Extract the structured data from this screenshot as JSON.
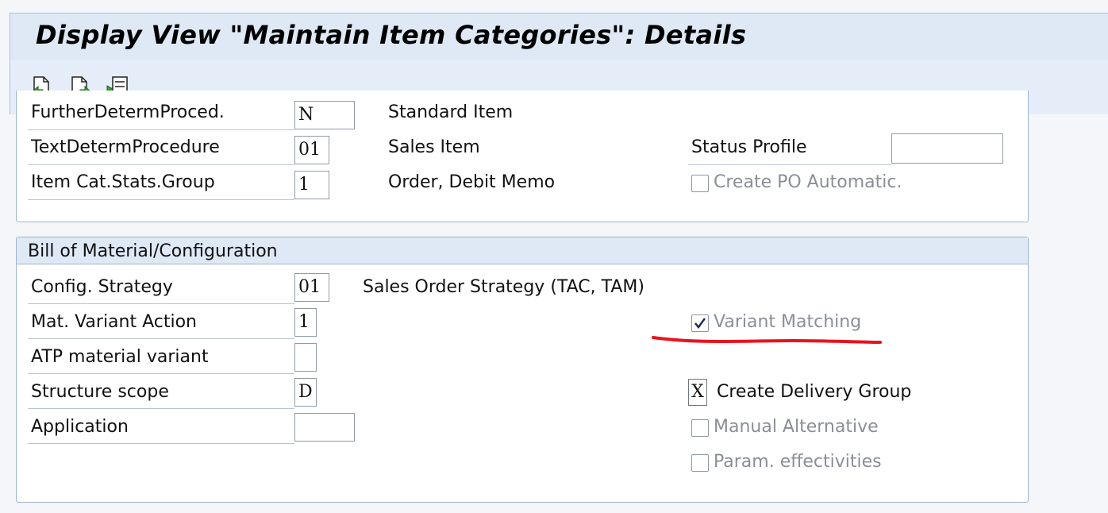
{
  "window": {
    "title": "Display View \"Maintain Item Categories\": Details"
  },
  "toolbar": {
    "icons": [
      "previous-entry-icon",
      "next-entry-icon",
      "other-entry-icon"
    ]
  },
  "group_top": {
    "rows": [
      {
        "label": "FurtherDetermProced.",
        "value": "N",
        "desc": "Standard Item"
      },
      {
        "label": "TextDetermProcedure",
        "value": "01",
        "desc": "Sales Item"
      },
      {
        "label": "Item Cat.Stats.Group",
        "value": "1",
        "desc": "Order, Debit Memo"
      }
    ],
    "status_profile_label": "Status Profile",
    "status_profile_value": "",
    "create_po_label": "Create PO Automatic.",
    "create_po_checked": false
  },
  "group_bom": {
    "title": "Bill of Material/Configuration",
    "rows": [
      {
        "label": "Config. Strategy",
        "value": "01",
        "desc": "Sales Order Strategy (TAC, TAM)"
      },
      {
        "label": "Mat. Variant Action",
        "value": "1"
      },
      {
        "label": "ATP material variant",
        "value": ""
      },
      {
        "label": "Structure scope",
        "value": "D"
      },
      {
        "label": "Application",
        "value": ""
      }
    ],
    "variant_matching_label": "Variant Matching",
    "variant_matching_checked": true,
    "create_delivery_group_label": "Create Delivery Group",
    "create_delivery_group_value": "X",
    "manual_alternative_label": "Manual Alternative",
    "manual_alternative_checked": false,
    "param_effectivities_label": "Param. effectivities",
    "param_effectivities_checked": false
  },
  "colors": {
    "annotation_underline": "#e8141c",
    "header_bg": "#dfe9f5",
    "group_border": "#9db5d1"
  }
}
